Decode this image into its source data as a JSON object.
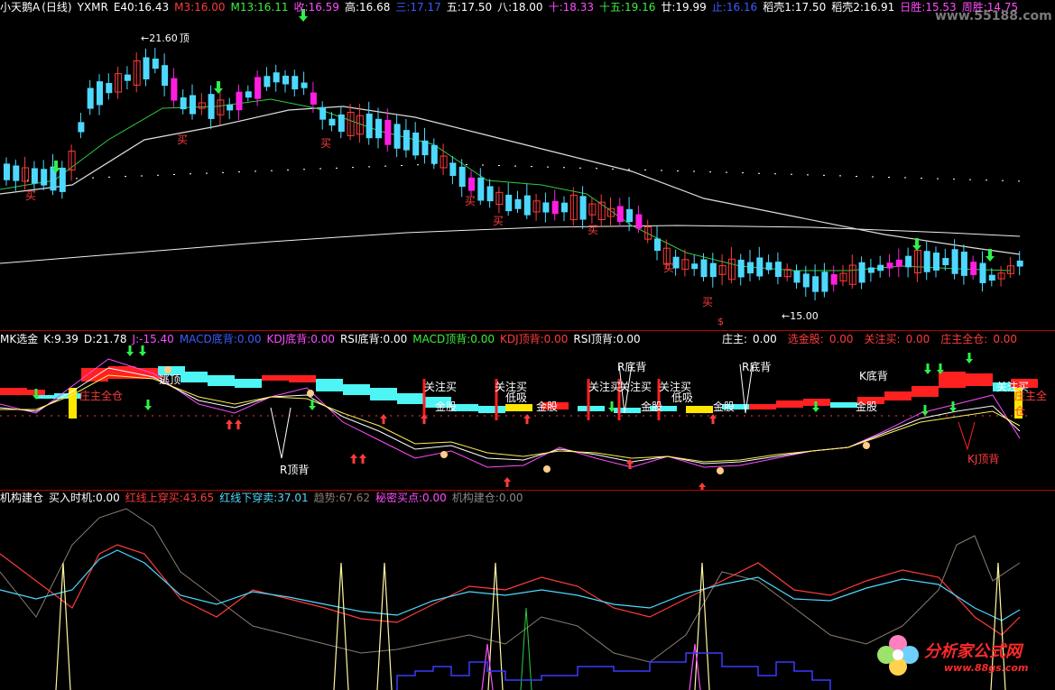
{
  "main_header": {
    "name": "小天鹅A",
    "period": "(日线)",
    "code": "YXMR",
    "items": [
      {
        "label": "E40:",
        "value": "16.43",
        "color": "#ffffff"
      },
      {
        "label": "M3:",
        "value": "16.00",
        "color": "#ff3b3b"
      },
      {
        "label": "M13:",
        "value": "16.11",
        "color": "#3cf03c"
      },
      {
        "label": "收:",
        "value": "16.59",
        "color": "#ff4dff"
      },
      {
        "label": "高:",
        "value": "16.68",
        "color": "#ffffff"
      },
      {
        "label": "三:",
        "value": "17.17",
        "color": "#3b5cff"
      },
      {
        "label": "五:",
        "value": "17.50",
        "color": "#ffffff"
      },
      {
        "label": "八:",
        "value": "18.00",
        "color": "#ffffff"
      },
      {
        "label": "十:",
        "value": "18.33",
        "color": "#ff4dff"
      },
      {
        "label": "十五:",
        "value": "19.16",
        "color": "#3cf03c"
      },
      {
        "label": "廿:",
        "value": "19.99",
        "color": "#ffffff"
      },
      {
        "label": "止:",
        "value": "16.16",
        "color": "#3b5cff"
      },
      {
        "label": "稻壳1:",
        "value": "17.50",
        "color": "#ffffff"
      },
      {
        "label": "稻壳2:",
        "value": "16.91",
        "color": "#ffffff"
      },
      {
        "label": "日胜:",
        "value": "15.53",
        "color": "#ff4dff"
      },
      {
        "label": "周胜:",
        "value": "14.75",
        "color": "#ff4dff"
      }
    ]
  },
  "price_annotations": {
    "high": "21.60",
    "high_tag": "顶",
    "low": "15.00",
    "buy_label": "买",
    "dollar_label": "$"
  },
  "mk_header": {
    "name": "MK选金",
    "items": [
      {
        "label": "K:",
        "value": "9.39",
        "color": "#ffffff"
      },
      {
        "label": "D:",
        "value": "21.78",
        "color": "#ffffff"
      },
      {
        "label": "J:",
        "value": "-15.40",
        "color": "#ff4dff"
      },
      {
        "label": "MACD底背:",
        "value": "0.00",
        "color": "#3b5cff"
      },
      {
        "label": "KDJ底背:",
        "value": "0.00",
        "color": "#ff4dff"
      },
      {
        "label": "RSI底背:",
        "value": "0.00",
        "color": "#ffffff"
      },
      {
        "label": "MACD顶背:",
        "value": "0.00",
        "color": "#3cf03c"
      },
      {
        "label": "KDJ顶背:",
        "value": "0.00",
        "color": "#ff3b3b"
      },
      {
        "label": "RSI顶背:",
        "value": "0.00",
        "color": "#ffffff"
      }
    ],
    "right_items": [
      {
        "label": "庄主:",
        "value": "0.00",
        "color": "#ffffff"
      },
      {
        "label": "选金股:",
        "value": "0.00",
        "color": "#ff3b3b"
      },
      {
        "label": "关注买:",
        "value": "0.00",
        "color": "#ff3b3b"
      },
      {
        "label": "庄主全仓:",
        "value": "0.00",
        "color": "#ff3b3b"
      }
    ]
  },
  "mk_annotations": {
    "focus_buy": "关注买",
    "gold_stock": "金股",
    "low_absorb": "低吸",
    "r_bottom": "R底背",
    "r_top": "R顶背",
    "k_bottom": "K底背",
    "kj_top": "KJ顶背",
    "escape_top": "逃顶",
    "main_full": "庄主全仓"
  },
  "jg_header": {
    "name": "机构建仓",
    "items": [
      {
        "label": "买入时机:",
        "value": "0.00",
        "color": "#ffffff"
      },
      {
        "label": "红线上穿买:",
        "value": "43.65",
        "color": "#ff3b3b"
      },
      {
        "label": "红线下穿卖:",
        "value": "37.01",
        "color": "#4dd9ff"
      },
      {
        "label": "趋势:",
        "value": "67.62",
        "color": "#8a7d70"
      },
      {
        "label": "秘密买点:",
        "value": "0.00",
        "color": "#ff4dff"
      },
      {
        "label": "机构建仓:",
        "value": "0.00",
        "color": "#8a8a8a"
      }
    ]
  },
  "watermark": {
    "top_site": "www.55188.com",
    "brand": "分析家公式网",
    "brand_url": "www.88gs.com"
  },
  "colors": {
    "up": "#ff3b3b",
    "down": "#4dd9ff",
    "magenta": "#ff1ee0",
    "ma_green": "#2ecc40",
    "ma_white": "#f0f0f0"
  }
}
